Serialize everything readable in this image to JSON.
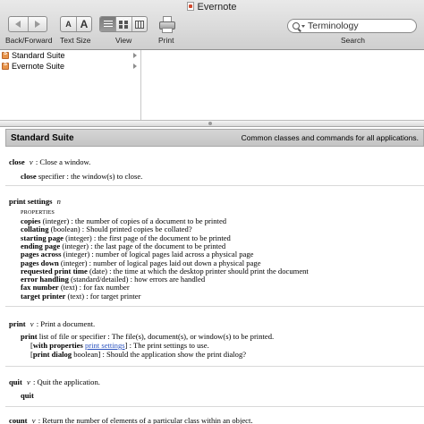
{
  "window": {
    "title": "Evernote"
  },
  "toolbar": {
    "back_forward_label": "Back/Forward",
    "text_size_label": "Text Size",
    "text_size_small": "A",
    "text_size_large": "A",
    "view_label": "View",
    "print_label": "Print",
    "search_label": "Search",
    "search_value": "Terminology"
  },
  "browser": {
    "items": [
      {
        "label": "Standard Suite"
      },
      {
        "label": "Evernote Suite"
      }
    ]
  },
  "dictionary": {
    "suite_name": "Standard Suite",
    "suite_description": "Common classes and commands for all applications.",
    "close": {
      "name": "close",
      "kind": "v",
      "desc": ": Close a window.",
      "param_name": "close",
      "param_desc": "specifier : the window(s) to close."
    },
    "print_settings": {
      "name": "print settings",
      "kind": "n",
      "properties_label": "PROPERTIES",
      "props": [
        {
          "name": "copies",
          "desc": "(integer) : the number of copies of a document to be printed"
        },
        {
          "name": "collating",
          "desc": "(boolean) : Should printed copies be collated?"
        },
        {
          "name": "starting page",
          "desc": "(integer) : the first page of the document to be printed"
        },
        {
          "name": "ending page",
          "desc": "(integer) : the last page of the document to be printed"
        },
        {
          "name": "pages across",
          "desc": "(integer) : number of logical pages laid across a physical page"
        },
        {
          "name": "pages down",
          "desc": "(integer) : number of logical pages laid out down a physical page"
        },
        {
          "name": "requested print time",
          "desc": "(date) : the time at which the desktop printer should print the document"
        },
        {
          "name": "error handling",
          "desc": "(standard/detailed) : how errors are handled"
        },
        {
          "name": "fax number",
          "desc": "(text) : for fax number"
        },
        {
          "name": "target printer",
          "desc": "(text) : for target printer"
        }
      ]
    },
    "print": {
      "name": "print",
      "kind": "v",
      "desc": ": Print a document.",
      "param_name": "print",
      "param_desc": "list of file or specifier : The file(s), document(s), or window(s) to be printed.",
      "opt1_open": "[",
      "opt1_name": "with properties",
      "opt1_link": "print settings",
      "opt1_rest": "] : The print settings to use.",
      "opt2_open": "[",
      "opt2_name": "print dialog",
      "opt2_rest": "boolean] : Should the application show the print dialog?"
    },
    "quit": {
      "name": "quit",
      "kind": "v",
      "desc": ": Quit the application.",
      "param_name": "quit"
    },
    "count": {
      "name": "count",
      "kind": "v",
      "desc": ": Return the number of elements of a particular class within an object."
    }
  }
}
